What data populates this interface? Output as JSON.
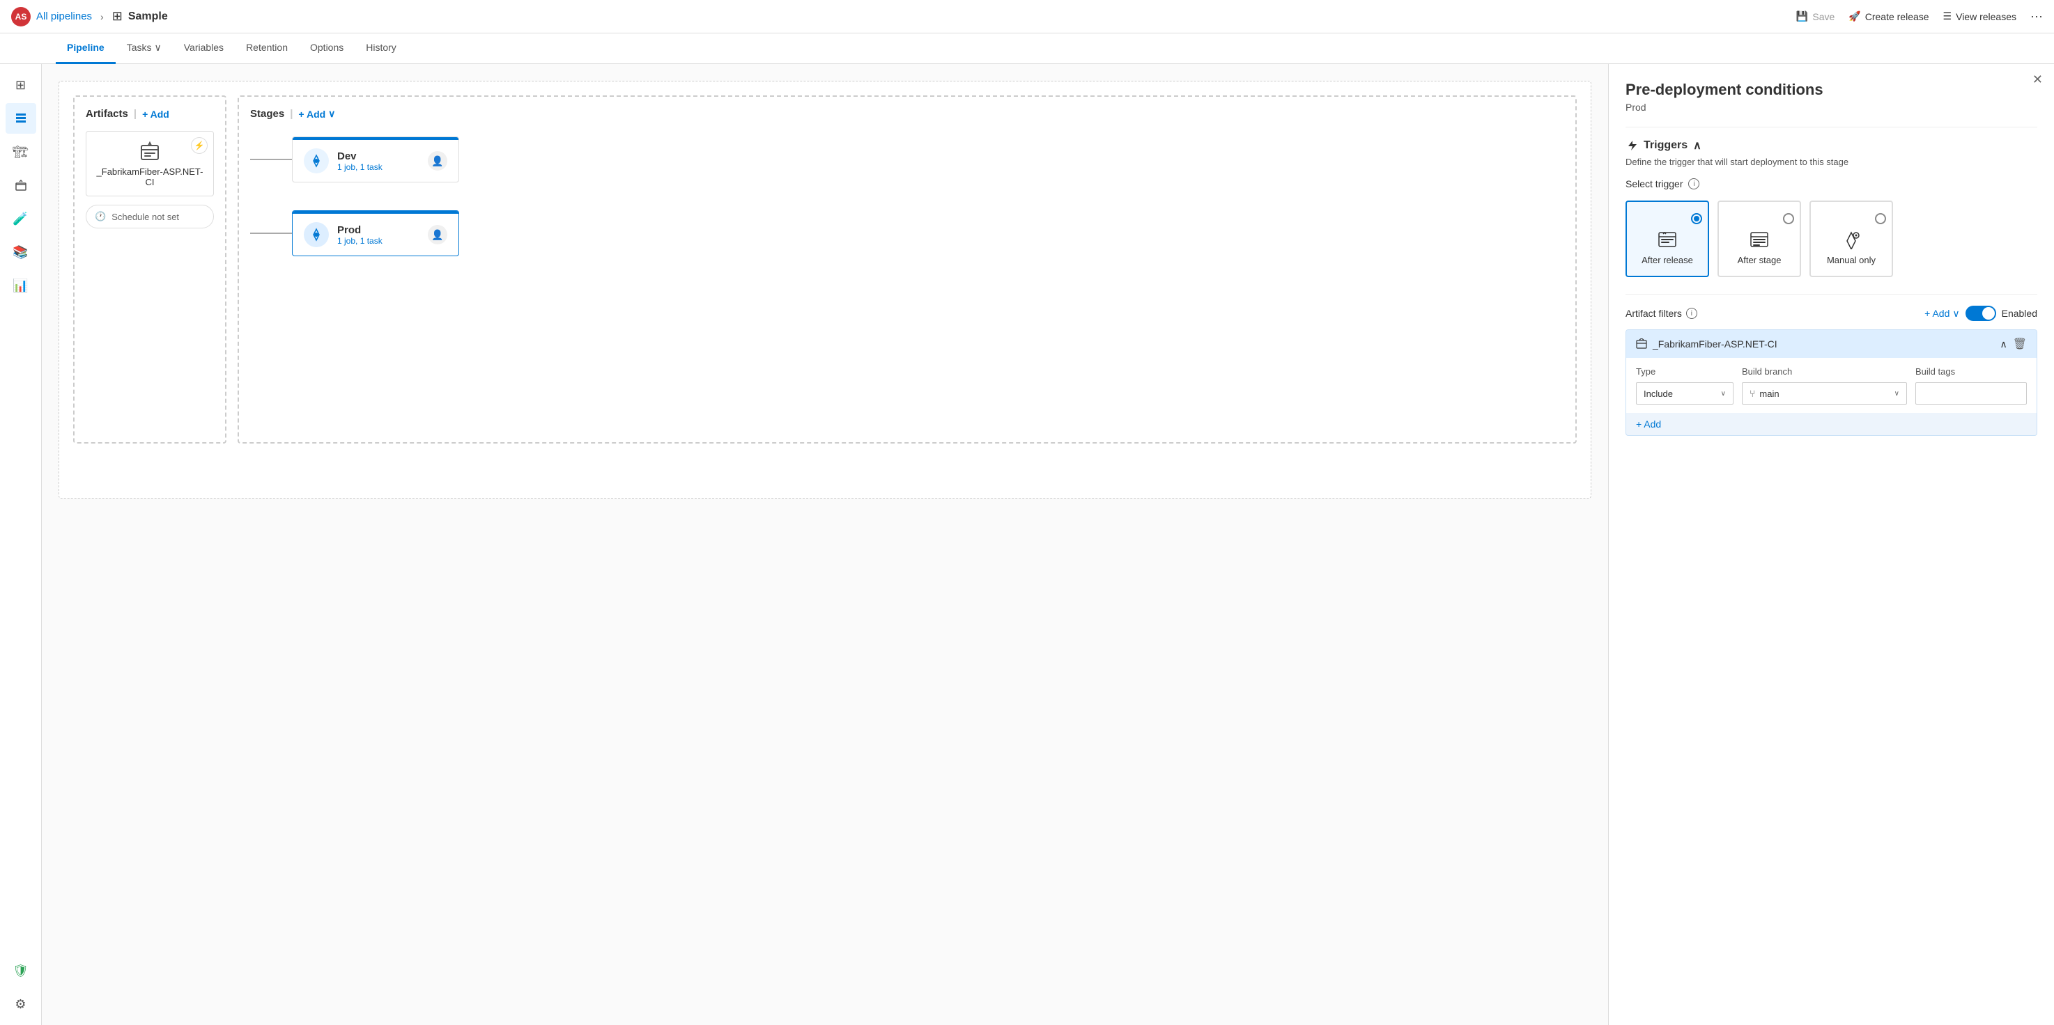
{
  "topbar": {
    "avatar_initials": "AS",
    "pipelines_label": "All pipelines",
    "chevron": ">",
    "pipeline_icon": "⊞",
    "pipeline_name": "Sample",
    "save_label": "Save",
    "create_release_label": "Create release",
    "view_releases_label": "View releases",
    "more_icon": "···"
  },
  "nav": {
    "tabs": [
      {
        "id": "pipeline",
        "label": "Pipeline",
        "active": true
      },
      {
        "id": "tasks",
        "label": "Tasks",
        "has_dropdown": true
      },
      {
        "id": "variables",
        "label": "Variables",
        "active": false
      },
      {
        "id": "retention",
        "label": "Retention",
        "active": false
      },
      {
        "id": "options",
        "label": "Options",
        "active": false
      },
      {
        "id": "history",
        "label": "History",
        "active": false
      }
    ]
  },
  "sidebar": {
    "items": [
      {
        "id": "overview",
        "icon": "⊞",
        "active": false
      },
      {
        "id": "pipelines",
        "icon": "↑",
        "active": true
      },
      {
        "id": "deployments",
        "icon": "🏗",
        "active": false
      },
      {
        "id": "artifacts",
        "icon": "📦",
        "active": false
      },
      {
        "id": "test-plans",
        "icon": "🧪",
        "active": false
      },
      {
        "id": "wiki",
        "icon": "📚",
        "active": false
      },
      {
        "id": "reports",
        "icon": "📊",
        "active": false
      }
    ],
    "bottom_items": [
      {
        "id": "security",
        "icon": "🛡",
        "special": true
      },
      {
        "id": "settings",
        "icon": "⚙"
      }
    ]
  },
  "canvas": {
    "artifacts_label": "Artifacts",
    "add_label": "+ Add",
    "stages_label": "Stages",
    "add_dropdown_label": "+ Add",
    "artifact": {
      "icon": "⊞",
      "name": "_FabrikamFiber-ASP.NET-CI",
      "lightning_icon": "⚡"
    },
    "schedule": {
      "icon": "🕐",
      "label": "Schedule not set"
    },
    "stages": [
      {
        "name": "Dev",
        "meta": "1 job, 1 task",
        "icon": "⚡",
        "selected": false
      },
      {
        "name": "Prod",
        "meta": "1 job, 1 task",
        "icon": "⚡",
        "selected": true
      }
    ]
  },
  "panel": {
    "title": "Pre-deployment conditions",
    "subtitle": "Prod",
    "triggers_label": "Triggers",
    "triggers_desc": "Define the trigger that will start deployment to this stage",
    "select_trigger_label": "Select trigger",
    "trigger_options": [
      {
        "id": "after-release",
        "label": "After release",
        "icon": "⊞",
        "selected": true
      },
      {
        "id": "after-stage",
        "label": "After stage",
        "icon": "≡",
        "selected": false
      },
      {
        "id": "manual-only",
        "label": "Manual only",
        "icon": "⚡",
        "selected": false
      }
    ],
    "artifact_filters_label": "Artifact filters",
    "add_filter_label": "+ Add",
    "enabled_label": "Enabled",
    "filter": {
      "title": "_FabrikamFiber-ASP.NET-CI",
      "icon": "⊞",
      "type_col": "Type",
      "branch_col": "Build branch",
      "tags_col": "Build tags",
      "type_value": "Include",
      "branch_value": "main",
      "tags_placeholder": ""
    },
    "add_filter_row_label": "+ Add"
  }
}
